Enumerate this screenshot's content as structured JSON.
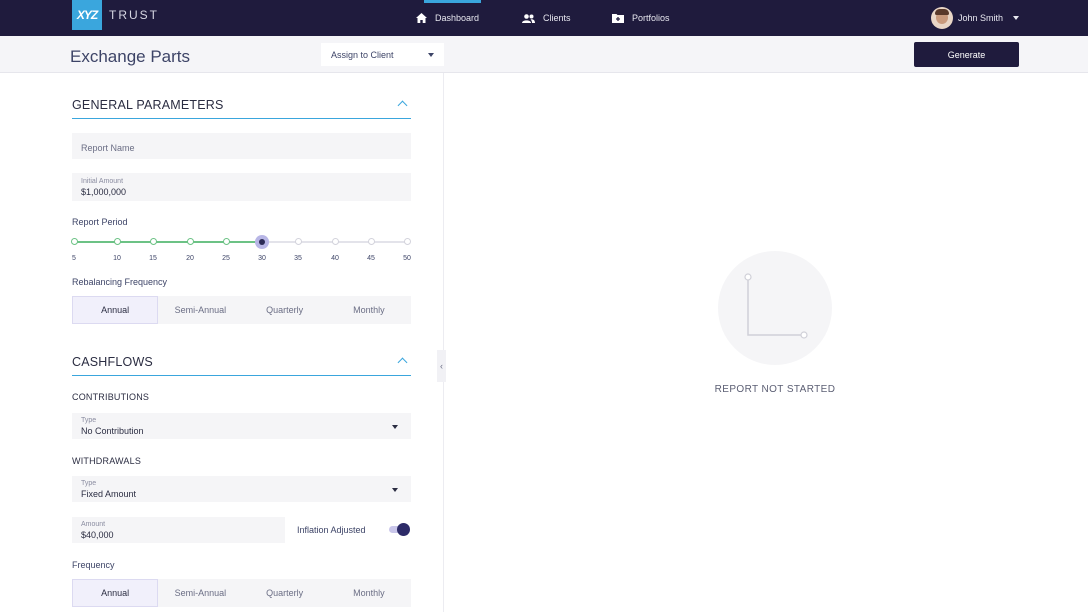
{
  "brand": {
    "logo_mark": "XYZ",
    "logo_text": "TRUST",
    "accent": "#3aa6dd",
    "nav_bg": "#1f1b3d"
  },
  "nav": {
    "items": [
      {
        "label": "Dashboard",
        "icon": "home-icon",
        "active": true
      },
      {
        "label": "Clients",
        "icon": "users-icon",
        "active": false
      },
      {
        "label": "Portfolios",
        "icon": "folder-plus-icon",
        "active": false
      }
    ],
    "user_name": "John Smith"
  },
  "header": {
    "title": "Exchange Parts",
    "assign_label": "Assign to Client",
    "generate_label": "Generate"
  },
  "general": {
    "title": "GENERAL PARAMETERS",
    "report_name_placeholder": "Report Name",
    "initial_amount_label": "Initial Amount",
    "initial_amount_value": "$1,000,000",
    "report_period_label": "Report Period",
    "period_ticks": [
      "5",
      "10",
      "15",
      "20",
      "25",
      "30",
      "35",
      "40",
      "45",
      "50"
    ],
    "period_selected": "30",
    "rebalancing_label": "Rebalancing Frequency",
    "rebalancing_options": [
      "Annual",
      "Semi-Annual",
      "Quarterly",
      "Monthly"
    ],
    "rebalancing_selected": "Annual"
  },
  "cashflows": {
    "title": "CASHFLOWS",
    "contributions_label": "CONTRIBUTIONS",
    "contribution_type_label": "Type",
    "contribution_type_value": "No Contribution",
    "withdrawals_label": "WITHDRAWALS",
    "withdrawal_type_label": "Type",
    "withdrawal_type_value": "Fixed Amount",
    "amount_label": "Amount",
    "amount_value": "$40,000",
    "inflation_label": "Inflation Adjusted",
    "inflation_on": true,
    "frequency_label": "Frequency",
    "frequency_options": [
      "Annual",
      "Semi-Annual",
      "Quarterly",
      "Monthly"
    ],
    "frequency_selected": "Annual"
  },
  "report": {
    "status_text": "REPORT NOT STARTED"
  }
}
